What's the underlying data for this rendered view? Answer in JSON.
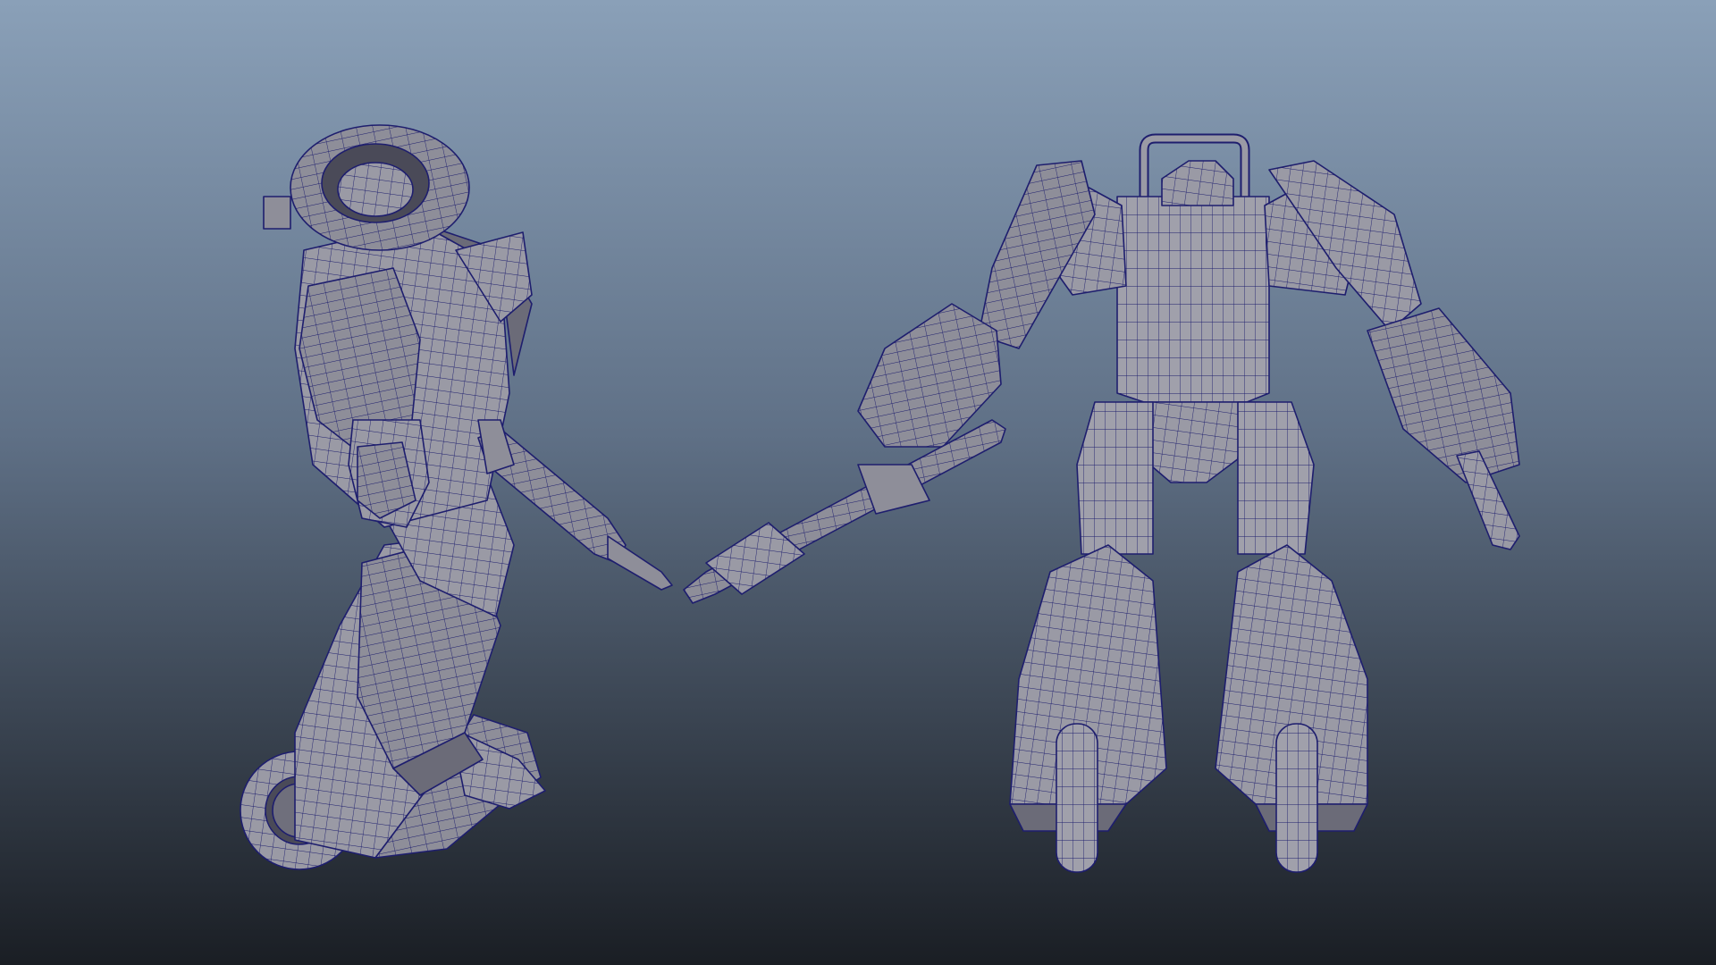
{
  "viewport": {
    "shading": "wireframe-on-shaded",
    "background_gradient": {
      "top": "#8aa0b8",
      "bottom": "#1a1e24"
    },
    "mesh_color": "#9a9aa5",
    "wire_color": "#1e1e6e"
  },
  "scene": {
    "objects": [
      {
        "name": "robot-side-view",
        "view": "side",
        "holds": "rifle"
      },
      {
        "name": "robot-back-view",
        "view": "back",
        "holds": "rifle"
      }
    ]
  }
}
